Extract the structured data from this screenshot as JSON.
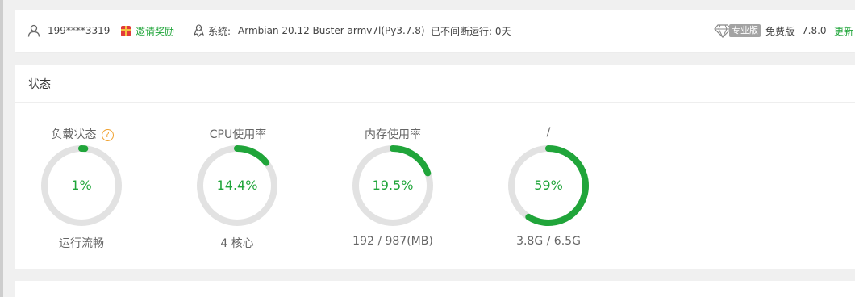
{
  "header": {
    "user": "199****3319",
    "invite_label": "邀请奖励",
    "system_label": "系统:",
    "system_value": "Armbian 20.12 Buster armv7l(Py3.7.8)",
    "uptime": "已不间断运行: 0天",
    "pro_badge": "专业版",
    "edition": "免费版",
    "version": "7.8.0",
    "update_label": "更新"
  },
  "status": {
    "title": "状态",
    "gauges": [
      {
        "label": "负载状态",
        "value_text": "1%",
        "percent": 1,
        "sub": "运行流畅",
        "has_help": true
      },
      {
        "label": "CPU使用率",
        "value_text": "14.4%",
        "percent": 14.4,
        "sub": "4 核心",
        "has_help": false
      },
      {
        "label": "内存使用率",
        "value_text": "19.5%",
        "percent": 19.5,
        "sub": "192 / 987(MB)",
        "has_help": false
      },
      {
        "label": "/",
        "value_text": "59%",
        "percent": 59,
        "sub": "3.8G / 6.5G",
        "has_help": false
      }
    ],
    "help_glyph": "?"
  },
  "colors": {
    "accent": "#20a53a",
    "track": "#e2e2e2",
    "help": "#f0a12f"
  }
}
